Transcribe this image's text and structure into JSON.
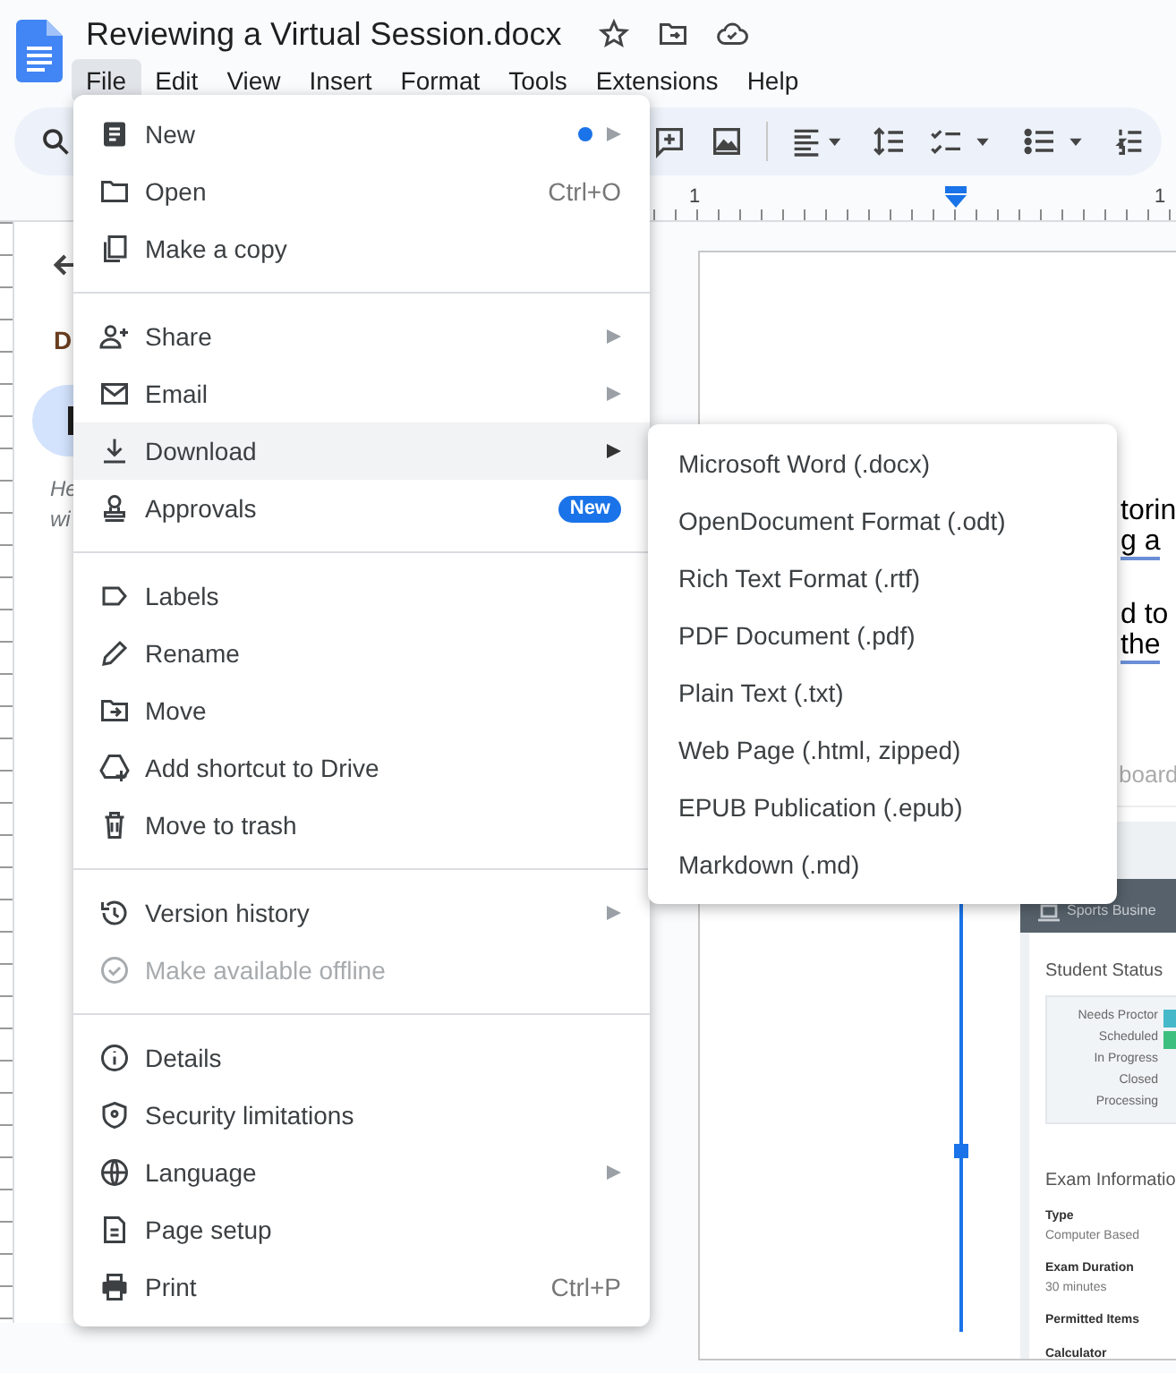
{
  "title": "Reviewing a Virtual Session.docx",
  "menubar": [
    {
      "label": "File",
      "selected": true
    },
    {
      "label": "Edit",
      "selected": false
    },
    {
      "label": "View",
      "selected": false
    },
    {
      "label": "Insert",
      "selected": false
    },
    {
      "label": "Format",
      "selected": false
    },
    {
      "label": "Tools",
      "selected": false
    },
    {
      "label": "Extensions",
      "selected": false
    },
    {
      "label": "Help",
      "selected": false
    }
  ],
  "ruler": [
    "1",
    "1"
  ],
  "sidebar": {
    "heading": "D",
    "hint_lines": [
      "He",
      "wi"
    ]
  },
  "file_menu": {
    "sections": [
      [
        {
          "label": "New",
          "submenu": true,
          "dot": true,
          "disabled": false,
          "selected": false
        },
        {
          "label": "Open",
          "shortcut": "Ctrl+O",
          "submenu": false,
          "dot": false,
          "disabled": false,
          "selected": false
        },
        {
          "label": "Make a copy",
          "submenu": false,
          "dot": false,
          "disabled": false,
          "selected": false
        }
      ],
      [
        {
          "label": "Share",
          "submenu": true,
          "dot": false,
          "disabled": false,
          "selected": false
        },
        {
          "label": "Email",
          "submenu": true,
          "dot": false,
          "disabled": false,
          "selected": false
        },
        {
          "label": "Download",
          "submenu": true,
          "dot": false,
          "disabled": false,
          "selected": true
        },
        {
          "label": "Approvals",
          "badge": "New",
          "submenu": false,
          "dot": false,
          "disabled": false,
          "selected": false
        }
      ],
      [
        {
          "label": "Labels",
          "submenu": false,
          "dot": false,
          "disabled": false,
          "selected": false
        },
        {
          "label": "Rename",
          "submenu": false,
          "dot": false,
          "disabled": false,
          "selected": false
        },
        {
          "label": "Move",
          "submenu": false,
          "dot": false,
          "disabled": false,
          "selected": false
        },
        {
          "label": "Add shortcut to Drive",
          "submenu": false,
          "dot": false,
          "disabled": false,
          "selected": false
        },
        {
          "label": "Move to trash",
          "submenu": false,
          "dot": false,
          "disabled": false,
          "selected": false
        }
      ],
      [
        {
          "label": "Version history",
          "submenu": true,
          "dot": false,
          "disabled": false,
          "selected": false
        },
        {
          "label": "Make available offline",
          "submenu": false,
          "dot": false,
          "disabled": true,
          "selected": false
        }
      ],
      [
        {
          "label": "Details",
          "submenu": false,
          "dot": false,
          "disabled": false,
          "selected": false
        },
        {
          "label": "Security limitations",
          "submenu": false,
          "dot": false,
          "disabled": false,
          "selected": false
        },
        {
          "label": "Language",
          "submenu": true,
          "dot": false,
          "disabled": false,
          "selected": false
        },
        {
          "label": "Page setup",
          "submenu": false,
          "dot": false,
          "disabled": false,
          "selected": false
        },
        {
          "label": "Print",
          "shortcut": "Ctrl+P",
          "submenu": false,
          "dot": false,
          "disabled": false,
          "selected": false
        }
      ]
    ]
  },
  "download_submenu": [
    "Microsoft Word (.docx)",
    "OpenDocument Format (.odt)",
    "Rich Text Format (.rtf)",
    "PDF Document (.pdf)",
    "Plain Text (.txt)",
    "Web Page (.html, zipped)",
    "EPUB Publication (.epub)",
    "Markdown (.md)"
  ],
  "document": {
    "paragraphs": [
      [
        {
          "text": "torin",
          "underlined": false
        },
        {
          "text": "g a",
          "underlined": true
        }
      ],
      [
        {
          "text": "d to",
          "underlined": false
        },
        {
          "text": "the",
          "underlined": true
        }
      ]
    ],
    "image": {
      "search_hint": "board",
      "header": "Sports Busine",
      "status_title": "Student Status",
      "status_rows": [
        {
          "label": "Needs Proctor",
          "color": "#45b9c9"
        },
        {
          "label": "Scheduled",
          "color": "#3fbf7f"
        },
        {
          "label": "In Progress"
        },
        {
          "label": "Closed"
        },
        {
          "label": "Processing"
        }
      ],
      "exam_title": "Exam Informatio",
      "fields": [
        {
          "label": "Type",
          "value": "Computer Based"
        },
        {
          "label": "Exam Duration",
          "value": "30 minutes"
        },
        {
          "label": "Permitted Items"
        },
        {
          "label": "Calculator"
        }
      ]
    }
  }
}
